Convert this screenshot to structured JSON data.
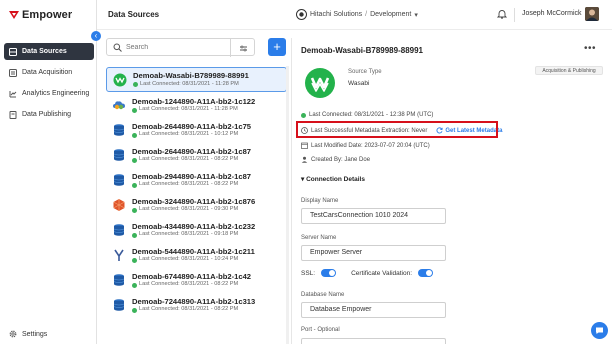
{
  "app": {
    "name": "Empower"
  },
  "sidebar": {
    "items": [
      {
        "label": "Data Sources",
        "icon": "database-icon",
        "active": true
      },
      {
        "label": "Data Acquisition",
        "icon": "acquisition-icon",
        "active": false
      },
      {
        "label": "Analytics Engineering",
        "icon": "analytics-icon",
        "active": false
      },
      {
        "label": "Data Publishing",
        "icon": "publishing-icon",
        "active": false
      }
    ],
    "settings_label": "Settings"
  },
  "header": {
    "title": "Data Sources",
    "org": "Hitachi Solutions",
    "org_separator": "/",
    "environment": "Development",
    "user_name": "Joseph McCormick"
  },
  "search": {
    "placeholder": "Search"
  },
  "sources": [
    {
      "name": "Demoab-Wasabi-B789989-88991",
      "connected": "Last Connected: 08/31/2021 - 11:28 PM",
      "icon": "wasabi"
    },
    {
      "name": "Demoab-1244890-A11A-bb2-1c122",
      "connected": "Last Connected: 08/31/2021 - 11:28 PM",
      "icon": "cloud"
    },
    {
      "name": "Demoab-2644890-A11A-bb2-1c75",
      "connected": "Last Connected: 08/31/2021 - 10:12 PM",
      "icon": "db"
    },
    {
      "name": "Demoab-2644890-A11A-bb2-1c87",
      "connected": "Last Connected: 08/31/2021 - 08:22 PM",
      "icon": "db"
    },
    {
      "name": "Demoab-2944890-A11A-bb2-1c87",
      "connected": "Last Connected: 08/31/2021 - 08:22 PM",
      "icon": "db"
    },
    {
      "name": "Demoab-3244890-A11A-bb2-1c876",
      "connected": "Last Connected: 08/31/2021 - 09:30 PM",
      "icon": "orange"
    },
    {
      "name": "Demoab-4344890-A11A-bb2-1c232",
      "connected": "Last Connected: 08/31/2021 - 09:18 PM",
      "icon": "db"
    },
    {
      "name": "Demoab-5444890-A11A-bb2-1c211",
      "connected": "Last Connected: 08/31/2021 - 10:24 PM",
      "icon": "y"
    },
    {
      "name": "Demoab-6744890-A11A-bb2-1c42",
      "connected": "Last Connected: 08/31/2021 - 08:22 PM",
      "icon": "db"
    },
    {
      "name": "Demoab-7244890-A11A-bb2-1c313",
      "connected": "Last Connected: 08/31/2021 - 08:22 PM",
      "icon": "db"
    }
  ],
  "detail": {
    "title": "Demoab-Wasabi-B789989-88991",
    "tag": "Acquisition & Publishing",
    "source_type_label": "Source Type",
    "source_type_value": "Wasabi",
    "last_connected": "Last Connected: 08/31/2021 - 12:38 PM (UTC)",
    "metadata_extraction": "Last Successful Metadata Extraction: Never",
    "get_metadata": "Get Latest Metadata",
    "last_modified": "Last Modified Date: 2023-07-07 20:04 (UTC)",
    "created_by": "Created By: Jane Doe",
    "connection_details": "Connection Details",
    "display_name_label": "Display Name",
    "display_name_value": "TestCarsConnection 1010 2024",
    "server_name_label": "Server Name",
    "server_name_value": "Empower Server",
    "ssl_label": "SSL:",
    "cert_label": "Certificate Validation:",
    "database_name_label": "Database Name",
    "database_name_value": "Database Empower",
    "port_label": "Port - Optional"
  },
  "colors": {
    "accent": "#2b7de9",
    "sidebar_active": "#2f3540",
    "highlight": "#d6101b",
    "success": "#3bb35a"
  }
}
